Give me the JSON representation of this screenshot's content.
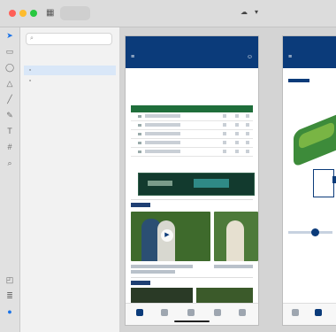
{
  "window": {
    "tabs": [
      {
        "label": "",
        "active": true
      },
      {
        "label": "",
        "active": false
      },
      {
        "label": "",
        "active": false
      }
    ],
    "document_name": ""
  },
  "layers": {
    "search_placeholder": "",
    "group_label": "",
    "items": [
      {
        "label": "",
        "selected": true
      },
      {
        "label": "",
        "selected": false
      }
    ]
  },
  "artboards": [
    {
      "label": ""
    },
    {
      "label": ""
    }
  ],
  "board1": {
    "status_time": "",
    "header_title": "",
    "subheader": "",
    "section_title": "",
    "leaderboard_rows": [
      {
        "name": "",
        "pos": "",
        "score": "",
        "thru": ""
      },
      {
        "name": "",
        "pos": "",
        "score": "",
        "thru": ""
      },
      {
        "name": "",
        "pos": "",
        "score": "",
        "thru": ""
      },
      {
        "name": "",
        "pos": "",
        "score": "",
        "thru": ""
      },
      {
        "name": "",
        "pos": "",
        "score": "",
        "thru": ""
      }
    ],
    "banner_text": "",
    "videos_section": "",
    "video_captions": [
      "",
      ""
    ],
    "news_section": ""
  },
  "board2": {
    "status_time": "",
    "hole_number": "",
    "hole_label": ""
  },
  "colors": {
    "brand_navy": "#0b3b7a",
    "accent_green": "#1f6e3b",
    "fairway": "#3d8b3a"
  },
  "icons": [
    "back-icon",
    "grid-icon",
    "chevron-down-icon",
    "cloud-icon",
    "search-icon",
    "play-icon"
  ]
}
